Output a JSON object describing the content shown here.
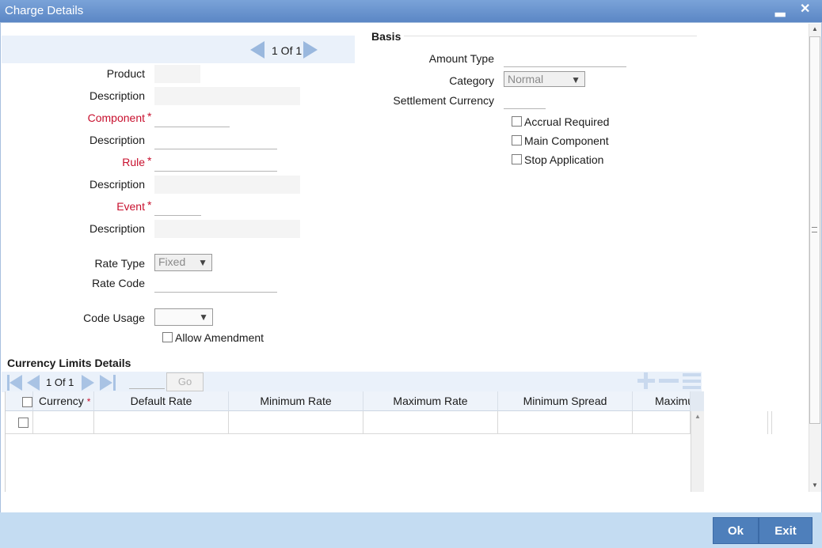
{
  "window": {
    "title": "Charge Details",
    "minimize": "▂",
    "close": "✕"
  },
  "pager": {
    "current": "1 Of 1"
  },
  "form": {
    "product_label": "Product",
    "description_label": "Description",
    "component_label": "Component",
    "rule_label": "Rule",
    "event_label": "Event",
    "required_mark": "*",
    "rate_type_label": "Rate Type",
    "rate_type_value": "Fixed",
    "rate_code_label": "Rate Code",
    "code_usage_label": "Code Usage",
    "code_usage_value": "",
    "allow_amendment_label": "Allow Amendment"
  },
  "basis": {
    "heading": "Basis",
    "amount_type_label": "Amount Type",
    "category_label": "Category",
    "category_value": "Normal",
    "settlement_currency_label": "Settlement Currency",
    "accrual_required_label": "Accrual Required",
    "main_component_label": "Main Component",
    "stop_application_label": "Stop Application"
  },
  "currency_limits": {
    "heading": "Currency Limits Details",
    "pager": "1 Of 1",
    "go_label": "Go",
    "columns": [
      "Currency",
      "Default Rate",
      "Minimum Rate",
      "Maximum Rate",
      "Minimum Spread",
      "Maximu"
    ],
    "required_mark": "*"
  },
  "footer": {
    "ok_label": "Ok",
    "exit_label": "Exit"
  },
  "colors": {
    "titlebar": "#5b87c5",
    "required": "#c8102e",
    "button": "#4e7fbb",
    "footer": "#c4dcf2"
  }
}
